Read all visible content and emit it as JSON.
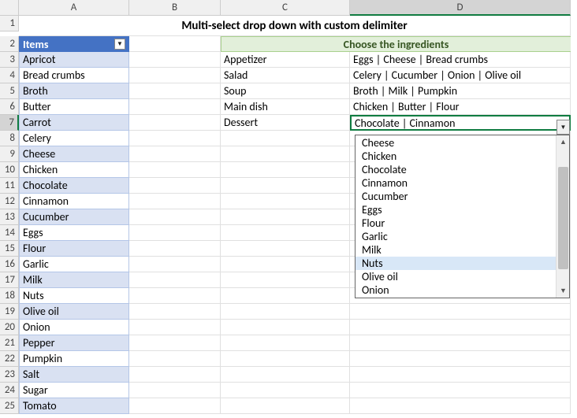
{
  "columns": [
    "A",
    "B",
    "C",
    "D"
  ],
  "row_headers": [
    1,
    2,
    3,
    4,
    5,
    6,
    7,
    8,
    9,
    10,
    11,
    12,
    13,
    14,
    15,
    16,
    17,
    18,
    19,
    20,
    21,
    22,
    23,
    24,
    25
  ],
  "title": "Multi-select drop down with custom delimiter",
  "items_header": "Items",
  "choose_header": "Choose the ingredients",
  "items": [
    "Apricot",
    "Bread crumbs",
    "Broth",
    "Butter",
    "Carrot",
    "Celery",
    "Cheese",
    "Chicken",
    "Chocolate",
    "Cinnamon",
    "Cucumber",
    "Eggs",
    "Flour",
    "Garlic",
    "Milk",
    "Nuts",
    "Olive oil",
    "Onion",
    "Pepper",
    "Pumpkin",
    "Salt",
    "Sugar",
    "Tomato"
  ],
  "meals": [
    {
      "name": "Appetizer",
      "ingredients": "Eggs | Cheese | Bread crumbs"
    },
    {
      "name": "Salad",
      "ingredients": "Celery | Cucumber | Onion | Olive oil"
    },
    {
      "name": "Soup",
      "ingredients": "Broth | Milk | Pumpkin"
    },
    {
      "name": "Main dish",
      "ingredients": "Chicken | Butter | Flour"
    },
    {
      "name": "Dessert",
      "ingredients": "Chocolate | Cinnamon"
    }
  ],
  "active_cell": "D7",
  "dropdown": {
    "options": [
      "Cheese",
      "Chicken",
      "Chocolate",
      "Cinnamon",
      "Cucumber",
      "Eggs",
      "Flour",
      "Garlic",
      "Milk",
      "Nuts",
      "Olive oil",
      "Onion"
    ],
    "highlighted": "Nuts"
  }
}
